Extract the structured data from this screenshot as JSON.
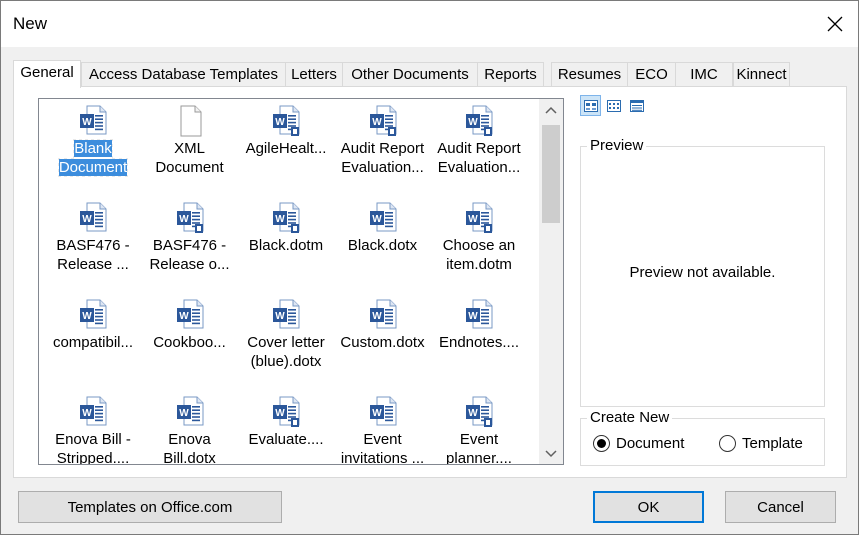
{
  "window": {
    "title": "New"
  },
  "tabs": [
    {
      "label": "General",
      "active": true
    },
    {
      "label": "Access Database Templates"
    },
    {
      "label": "Letters"
    },
    {
      "label": "Other Documents"
    },
    {
      "label": "Reports"
    },
    {
      "label": "Resumes"
    },
    {
      "label": "ECO"
    },
    {
      "label": "IMC"
    },
    {
      "label": "Kinnect"
    }
  ],
  "files": [
    {
      "label": "Blank\nDocument",
      "icon": "word-document-icon",
      "selected": true
    },
    {
      "label": "XML\nDocument",
      "icon": "blank-file-icon"
    },
    {
      "label": "AgileHealt...",
      "icon": "word-template-icon"
    },
    {
      "label": "Audit Report\nEvaluation...",
      "icon": "word-template-icon"
    },
    {
      "label": "Audit Report\nEvaluation...",
      "icon": "word-template-icon"
    },
    {
      "label": "BASF476 -\nRelease ...",
      "icon": "word-document-icon"
    },
    {
      "label": "BASF476 -\nRelease o...",
      "icon": "word-template-icon"
    },
    {
      "label": "Black.dotm",
      "icon": "word-template-icon"
    },
    {
      "label": "Black.dotx",
      "icon": "word-document-icon"
    },
    {
      "label": "Choose an\nitem.dotm",
      "icon": "word-template-icon"
    },
    {
      "label": "compatibil...",
      "icon": "word-document-icon"
    },
    {
      "label": "Cookboo...",
      "icon": "word-document-icon"
    },
    {
      "label": "Cover letter\n(blue).dotx",
      "icon": "word-document-icon"
    },
    {
      "label": "Custom.dotx",
      "icon": "word-document-icon"
    },
    {
      "label": "Endnotes....",
      "icon": "word-document-icon"
    },
    {
      "label": "Enova Bill -\nStripped....",
      "icon": "word-document-icon"
    },
    {
      "label": "Enova\nBill.dotx",
      "icon": "word-document-icon"
    },
    {
      "label": "Evaluate....",
      "icon": "word-template-icon"
    },
    {
      "label": "Event\ninvitations ...",
      "icon": "word-document-icon"
    },
    {
      "label": "Event\nplanner....",
      "icon": "word-template-icon"
    }
  ],
  "view_buttons": [
    {
      "name": "large-icons-view-icon",
      "active": true
    },
    {
      "name": "list-view-icon"
    },
    {
      "name": "details-view-icon"
    }
  ],
  "preview": {
    "title": "Preview",
    "message": "Preview not available."
  },
  "create_new": {
    "title": "Create New",
    "options": [
      {
        "label": "Document",
        "checked": true
      },
      {
        "label": "Template",
        "checked": false
      }
    ]
  },
  "buttons": {
    "templates_online": "Templates on Office.com",
    "ok": "OK",
    "cancel": "Cancel"
  },
  "colors": {
    "selection": "#3c8ddd",
    "word_blue": "#2b579a",
    "focus_border": "#0078d7"
  }
}
